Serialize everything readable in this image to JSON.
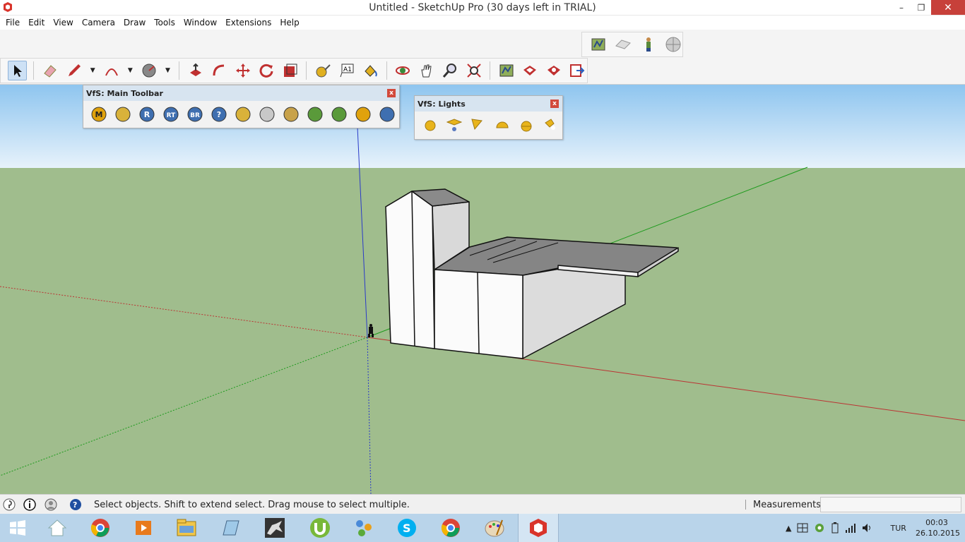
{
  "window": {
    "title": "Untitled - SketchUp Pro (30 days left in TRIAL)",
    "minimize": "–",
    "restore": "❐",
    "close": "✕"
  },
  "menu": [
    "File",
    "Edit",
    "View",
    "Camera",
    "Draw",
    "Tools",
    "Window",
    "Extensions",
    "Help"
  ],
  "aux_toolbar": [
    "model-info-icon",
    "sandbox-icon",
    "person-icon",
    "globe-icon"
  ],
  "main_toolbar": [
    "select-arrow-icon",
    "eraser-icon",
    "pencil-icon",
    "arc-icon",
    "circle-icon",
    "push-pull-icon",
    "follow-me-icon",
    "move-icon",
    "rotate-icon",
    "scale-icon",
    "tape-measure-icon",
    "text-icon",
    "paint-bucket-icon",
    "orbit-icon",
    "pan-icon",
    "zoom-icon",
    "zoom-extents-icon",
    "map-icon",
    "3d-warehouse-icon",
    "extension-warehouse-icon",
    "send-to-layout-icon"
  ],
  "vfs_main_toolbar": {
    "title": "VfS: Main Toolbar",
    "close": "x",
    "buttons": [
      {
        "name": "material-editor-button",
        "label": "M",
        "color": "#e0a20c"
      },
      {
        "name": "option-editor-button",
        "label": "",
        "color": "#d9b23a"
      },
      {
        "name": "render-button",
        "label": "R",
        "color": "#3f6fb0"
      },
      {
        "name": "render-rt-button",
        "label": "RT",
        "color": "#3f6fb0"
      },
      {
        "name": "batch-render-button",
        "label": "BR",
        "color": "#3f6fb0"
      },
      {
        "name": "help-button",
        "label": "?",
        "color": "#3f6fb0"
      },
      {
        "name": "tag-button",
        "label": "",
        "color": "#d9b23a"
      },
      {
        "name": "sphere-button",
        "label": "",
        "color": "#c8c8c8"
      },
      {
        "name": "plane-button",
        "label": "",
        "color": "#c8a24a"
      },
      {
        "name": "proxy-export-button",
        "label": "",
        "color": "#5a9a3a"
      },
      {
        "name": "proxy-import-button",
        "label": "",
        "color": "#5a9a3a"
      },
      {
        "name": "target-button",
        "label": "",
        "color": "#e0a20c"
      },
      {
        "name": "pause-button",
        "label": "",
        "color": "#3f6fb0"
      }
    ]
  },
  "vfs_lights": {
    "title": "VfS: Lights",
    "close": "x",
    "buttons": [
      "omni-light-icon",
      "rect-light-icon",
      "spot-light-icon",
      "dome-light-icon",
      "sphere-light-icon",
      "ies-light-icon"
    ]
  },
  "status": {
    "text": "Select objects. Shift to extend select. Drag mouse to select multiple.",
    "measurements_label": "Measurements",
    "measurements_value": ""
  },
  "taskbar": {
    "apps": [
      "start-icon",
      "home-icon",
      "chrome-icon",
      "media-player-icon",
      "file-explorer-icon",
      "book-icon",
      "rhino-icon",
      "utorrent-icon",
      "network-icon",
      "skype-icon",
      "chrome-icon",
      "paint-icon",
      "sketchup-icon"
    ],
    "language": "TUR",
    "time": "00:03",
    "date": "26.10.2015"
  }
}
